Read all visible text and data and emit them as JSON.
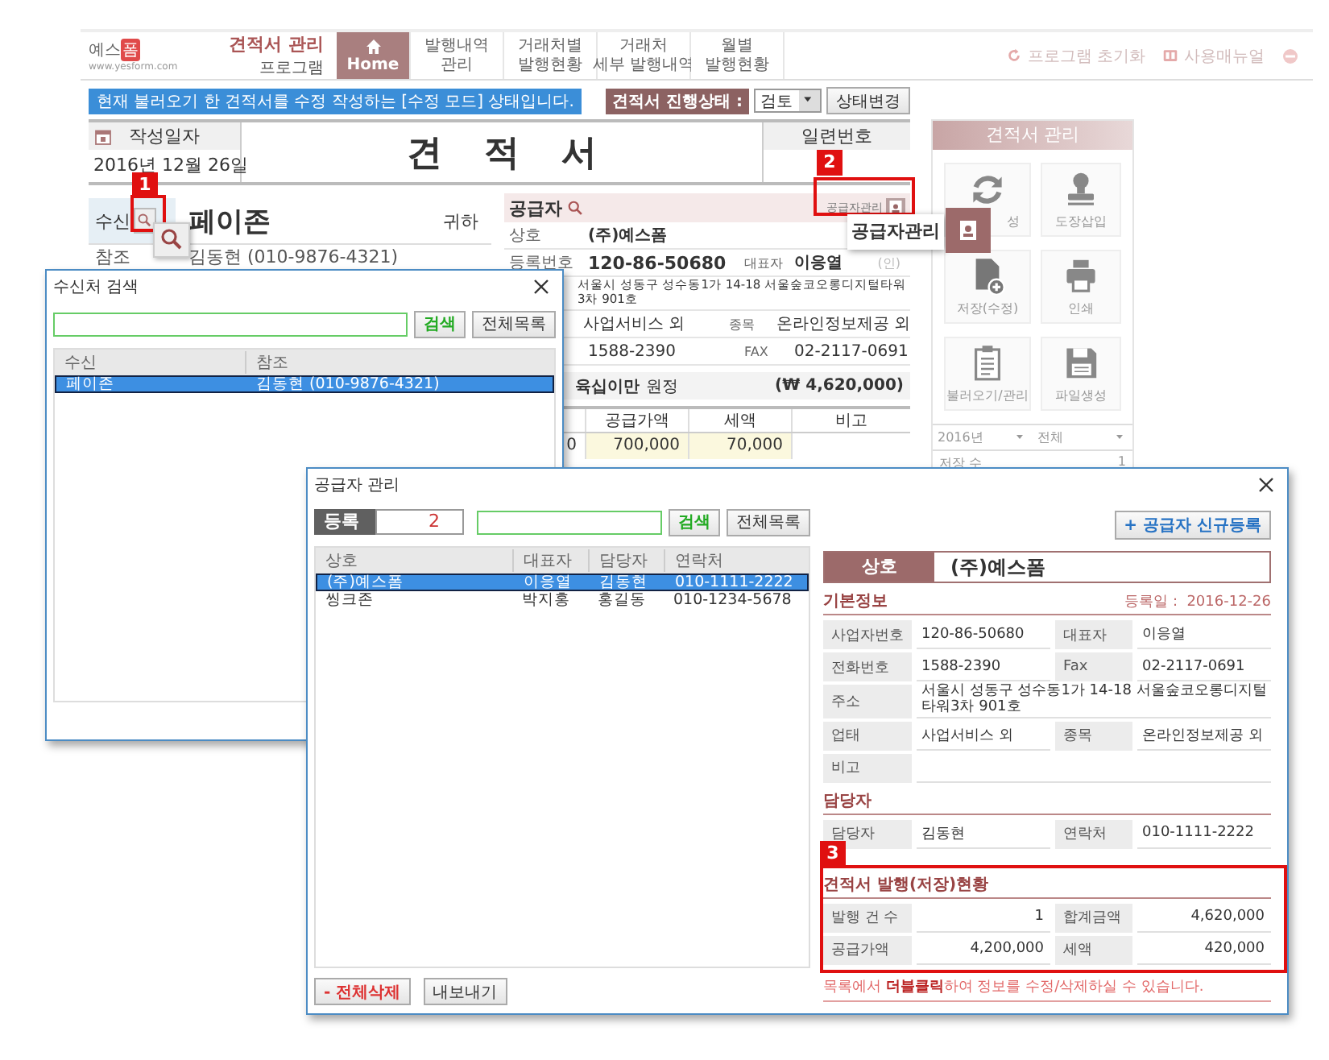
{
  "header": {
    "logo": {
      "text": "예스",
      "badge": "폼",
      "url": "www.yesform.com"
    },
    "title": "견적서 관리",
    "subtitle": "프로그램",
    "tabs": [
      {
        "kind": "home",
        "lines": [
          "Home"
        ],
        "selected": true
      },
      {
        "kind": "text",
        "lines": [
          "발행내역",
          "관리"
        ],
        "selected": false
      },
      {
        "kind": "text",
        "lines": [
          "거래처별",
          "발행현황"
        ],
        "selected": false
      },
      {
        "kind": "text",
        "lines": [
          "거래처",
          "세부 발행내역"
        ],
        "selected": false
      },
      {
        "kind": "text",
        "lines": [
          "월별",
          "발행현황"
        ],
        "selected": false
      }
    ],
    "tools": [
      {
        "kind": "reset",
        "label": "프로그램 초기화"
      },
      {
        "kind": "manual",
        "label": "사용매뉴얼"
      },
      {
        "kind": "info"
      }
    ]
  },
  "notice": "현재 불러오기 한 견적서를 수정 작성하는 [수정 모드] 상태입니다.",
  "status": {
    "label": "견적서 진행상태 :",
    "value": "검토",
    "button": "상태변경"
  },
  "document": {
    "date_label": "작성일자",
    "date": "2016년 12월 26일",
    "title": "견적서",
    "serial_label": "일련번호",
    "recipient": {
      "label": "수신",
      "name": "페이존",
      "suffix": "귀하",
      "ref_label": "참조",
      "ref": "김동현 (010-9876-4321)"
    },
    "supplier": {
      "label": "공급자",
      "manage": "공급자관리",
      "name_label": "상호",
      "name": "(주)예스폼",
      "reg_label": "등록번호",
      "reg": "120-86-50680",
      "ceo_label": "대표자",
      "ceo": "이응열",
      "seal": "(인)",
      "address": "서울시 성동구 성수동1가 14-18 서울숲코오롱디지털타워3차 901호",
      "business": "사업서비스 외",
      "item_label": "종목",
      "item": "온라인정보제공 외",
      "phone": "1588-2390",
      "fax_label": "FAX",
      "fax": "02-2117-0691"
    },
    "amount": {
      "words": "육십이만",
      "unit": "원정",
      "figure": "(₩ 4,620,000)"
    },
    "items": {
      "columns": [
        "공급가액",
        "세액",
        "비고"
      ],
      "rows": [
        {
          "column_1": "0",
          "cells": [
            "700,000",
            "70,000"
          ]
        }
      ]
    }
  },
  "panel": {
    "title": "견적서 관리",
    "actions": [
      {
        "kind": "refresh",
        "label": "성"
      },
      {
        "kind": "stamp",
        "label": "도장삽입"
      },
      {
        "kind": "save",
        "label": "저장(수정)"
      },
      {
        "kind": "print",
        "label": "인쇄"
      },
      {
        "kind": "clipboard",
        "label": "불러오기/관리"
      },
      {
        "kind": "floppy",
        "label": "파일생성"
      }
    ],
    "year": "2016년",
    "filter": "전체",
    "count_label": "저장 수",
    "count": "1"
  },
  "recipient_search": {
    "title": "수신처 검색",
    "search_button": "검색",
    "all_button": "전체목록",
    "columns": [
      "수신",
      "참조"
    ],
    "rows": [
      {
        "cells": [
          "페이존",
          "김동현 (010-9876-4321)"
        ],
        "selected": true
      }
    ]
  },
  "supplier_manager": {
    "title": "공급자 관리",
    "count_label": "등록",
    "count": "2",
    "search_button": "검색",
    "all_button": "전체목록",
    "columns": [
      "상호",
      "대표자",
      "담당자",
      "연락처"
    ],
    "rows": [
      {
        "cells": [
          "(주)예스폼",
          "이응열",
          "김동현",
          "010-1111-2222"
        ],
        "selected": true
      },
      {
        "cells": [
          "씽크존",
          "박지홍",
          "홍길동",
          "010-1234-5678"
        ],
        "selected": false
      }
    ],
    "delete_button": "- 전체삭제",
    "export_button": "내보내기",
    "new_button": "+ 공급자 신규등록",
    "name_label": "상호",
    "name": "(주)예스폼",
    "basic": {
      "title": "기본정보",
      "date": "등록일 :  2016-12-26",
      "fields": [
        {
          "kind": "pair",
          "label": "사업자번호",
          "value": "120-86-50680"
        },
        {
          "kind": "pair",
          "label": "대표자",
          "value": "이응열"
        },
        {
          "kind": "pair",
          "label": "전화번호",
          "value": "1588-2390"
        },
        {
          "kind": "pair",
          "label": "Fax",
          "value": "02-2117-0691"
        },
        {
          "kind": "wide",
          "label": "주소",
          "value": "서울시 성동구 성수동1가 14-18 서울숲코오롱디지털타워3차 901호"
        },
        {
          "kind": "pair",
          "label": "업태",
          "value": "사업서비스 외"
        },
        {
          "kind": "pair",
          "label": "종목",
          "value": "온라인정보제공 외"
        },
        {
          "kind": "wide",
          "label": "비고"
        }
      ]
    },
    "contact": {
      "title": "담당자",
      "fields": [
        {
          "kind": "pair",
          "label": "담당자",
          "value": "김동현"
        },
        {
          "kind": "pair",
          "label": "연락처",
          "value": "010-1111-2222"
        }
      ]
    },
    "stats": {
      "title": "견적서 발행(저장)현황",
      "fields": [
        {
          "kind": "pair",
          "label": "발행 건 수",
          "value": "1"
        },
        {
          "kind": "pair",
          "label": "합계금액",
          "value": "4,620,000"
        },
        {
          "kind": "pair",
          "label": "공급가액",
          "value": "4,200,000"
        },
        {
          "kind": "pair",
          "label": "세액",
          "value": "420,000"
        }
      ]
    },
    "note": "목록에서 **더블클릭**하여 정보를 수정/삭제하실 수 있습니다."
  },
  "callouts": [
    {
      "kind": "zoom",
      "number": "1"
    },
    {
      "kind": "popup",
      "number": "2",
      "label": "공급자관리"
    },
    {
      "kind": "frame",
      "number": "3"
    }
  ]
}
